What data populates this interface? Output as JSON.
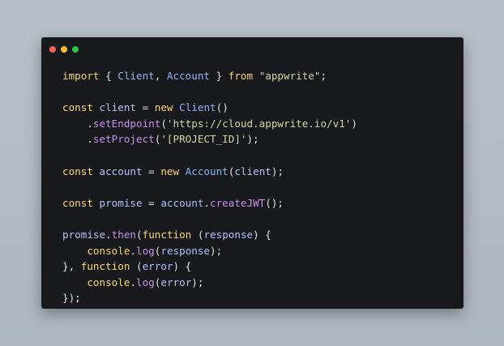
{
  "window": {
    "dots": [
      "#ff5f57",
      "#febc2e",
      "#28c840"
    ]
  },
  "code": {
    "line1": {
      "t1": "import",
      "t2": " { ",
      "t3": "Client",
      "t4": ", ",
      "t5": "Account",
      "t6": " } ",
      "t7": "from",
      "t8": " ",
      "t9": "\"appwrite\"",
      "t10": ";"
    },
    "line3": {
      "t1": "const",
      "t2": " ",
      "t3": "client",
      "t4": " = ",
      "t5": "new",
      "t6": " ",
      "t7": "Client",
      "t8": "()"
    },
    "line4": {
      "t1": "    .",
      "t2": "setEndpoint",
      "t3": "(",
      "t4": "'https://cloud.appwrite.io/v1'",
      "t5": ")"
    },
    "line5": {
      "t1": "    .",
      "t2": "setProject",
      "t3": "(",
      "t4": "'[PROJECT_ID]'",
      "t5": ");"
    },
    "line7": {
      "t1": "const",
      "t2": " ",
      "t3": "account",
      "t4": " = ",
      "t5": "new",
      "t6": " ",
      "t7": "Account",
      "t8": "(",
      "t9": "client",
      "t10": ");"
    },
    "line9": {
      "t1": "const",
      "t2": " ",
      "t3": "promise",
      "t4": " = ",
      "t5": "account",
      "t6": ".",
      "t7": "createJWT",
      "t8": "();"
    },
    "line11": {
      "t1": "promise",
      "t2": ".",
      "t3": "then",
      "t4": "(",
      "t5": "function",
      "t6": " (",
      "t7": "response",
      "t8": ") {"
    },
    "line12": {
      "t1": "    ",
      "t2": "console",
      "t3": ".",
      "t4": "log",
      "t5": "(",
      "t6": "response",
      "t7": ");"
    },
    "line13": {
      "t1": "}, ",
      "t2": "function",
      "t3": " (",
      "t4": "error",
      "t5": ") {"
    },
    "line14": {
      "t1": "    ",
      "t2": "console",
      "t3": ".",
      "t4": "log",
      "t5": "(",
      "t6": "error",
      "t7": ");"
    },
    "line15": {
      "t1": "});"
    }
  }
}
